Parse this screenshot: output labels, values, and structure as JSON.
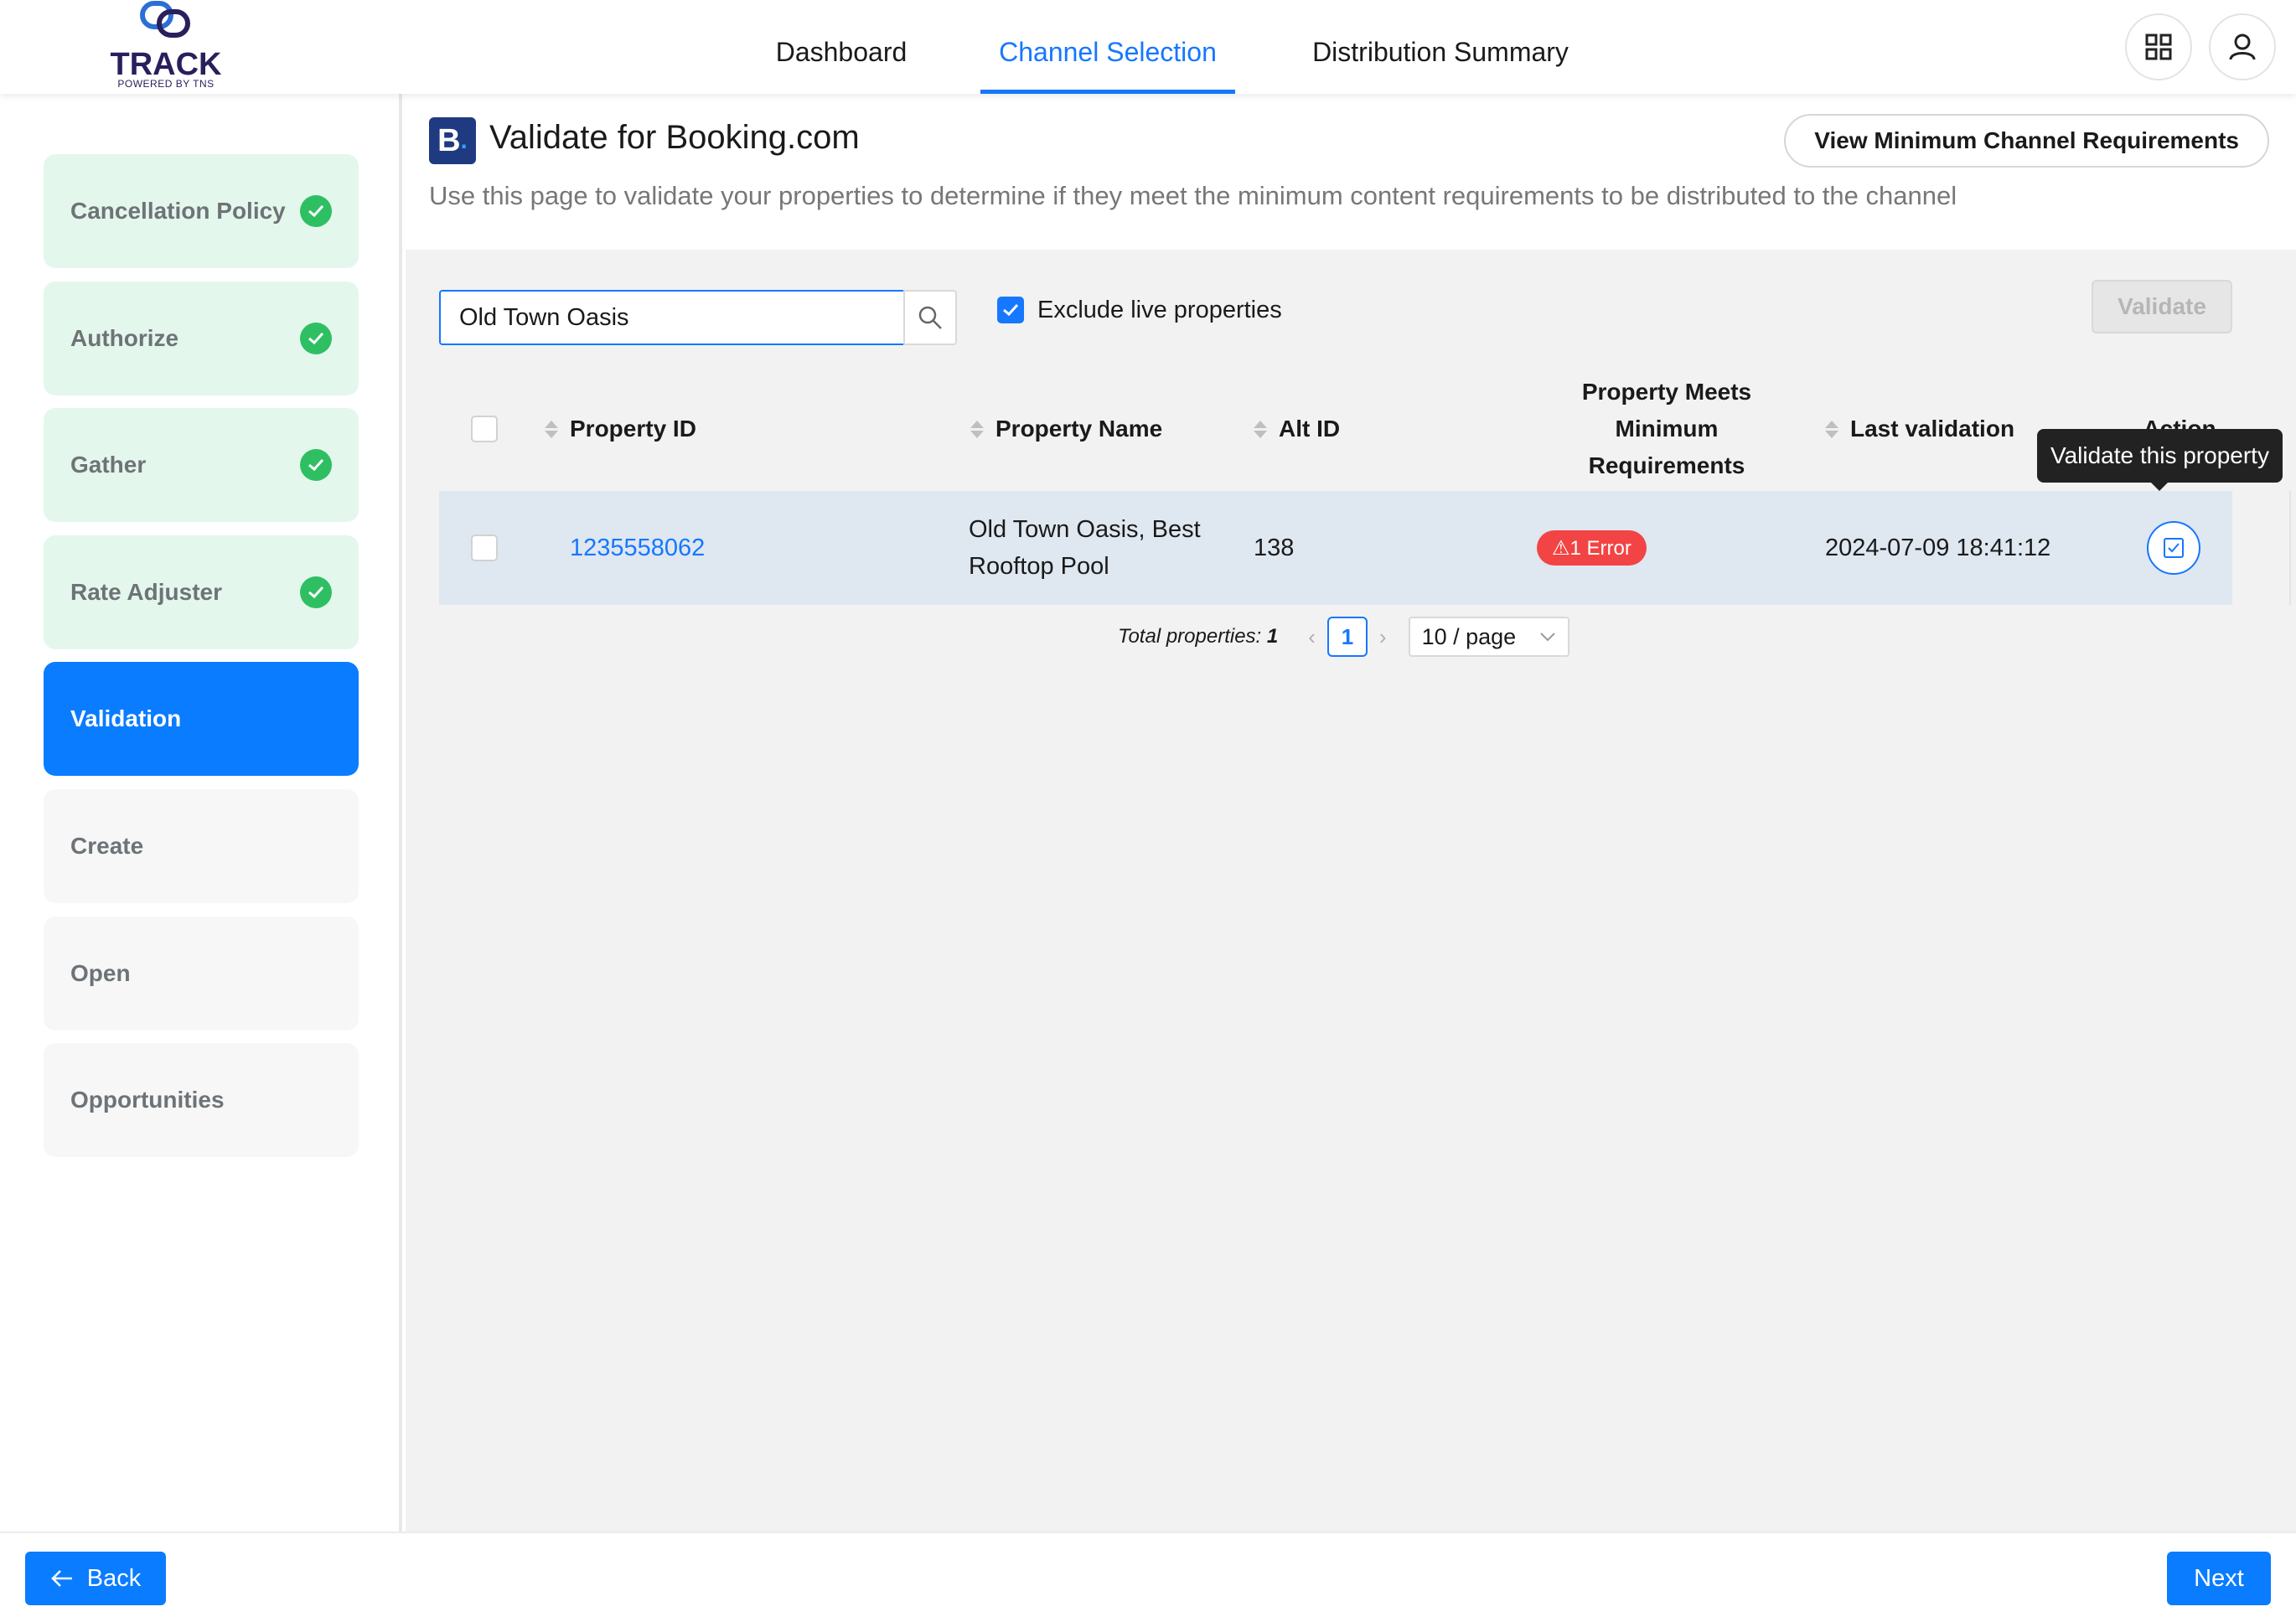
{
  "header": {
    "brand": {
      "name": "TRACK",
      "tagline": "POWERED BY TNS"
    },
    "nav_tabs": [
      {
        "label": "Dashboard",
        "active": false
      },
      {
        "label": "Channel Selection",
        "active": true
      },
      {
        "label": "Distribution Summary",
        "active": false
      }
    ],
    "buttons": [
      {
        "icon": "apps-grid-icon"
      },
      {
        "icon": "user-icon"
      }
    ]
  },
  "sidebar": {
    "steps": [
      {
        "label": "Cancellation Policy",
        "status": "done"
      },
      {
        "label": "Authorize",
        "status": "done"
      },
      {
        "label": "Gather",
        "status": "done"
      },
      {
        "label": "Rate Adjuster",
        "status": "done"
      },
      {
        "label": "Validation",
        "status": "current"
      },
      {
        "label": "Create",
        "status": "todo"
      },
      {
        "label": "Open",
        "status": "todo"
      },
      {
        "label": "Opportunities",
        "status": "todo"
      }
    ]
  },
  "page": {
    "channel_logo": "B",
    "title": "Validate for Booking.com",
    "description": "Use this page to validate your properties to determine if they meet the minimum content requirements to be distributed to the channel",
    "requirements_button": "View Minimum Channel Requirements"
  },
  "toolbar": {
    "search_value": "Old Town Oasis",
    "exclude_label": "Exclude live properties",
    "exclude_checked": true,
    "validate_label": "Validate",
    "validate_disabled": true
  },
  "table": {
    "columns": {
      "property_id": "Property ID",
      "property_name": "Property Name",
      "alt_id": "Alt ID",
      "meets_line1": "Property Meets",
      "meets_line2": "Minimum Requirements",
      "last_validation": "Last validation",
      "action": "Action"
    },
    "rows": [
      {
        "property_id": "1235558062",
        "property_name_line1": "Old Town Oasis, Best",
        "property_name_line2": "Rooftop Pool",
        "alt_id": "138",
        "status": "⚠1 Error",
        "last_validation": "2024-07-09 18:41:12"
      }
    ],
    "tooltip": "Validate this property"
  },
  "pagination": {
    "total_label": "Total properties:",
    "total_value": "1",
    "current_page": "1",
    "page_size": "10 / page"
  },
  "footer": {
    "back_label": "Back",
    "next_label": "Next"
  },
  "colors": {
    "accent": "#1677ff",
    "step_done_bg": "#e4f7ec",
    "check_green": "#2fbf63",
    "error_red": "#f24444",
    "brand_navy": "#2a1f5c"
  }
}
